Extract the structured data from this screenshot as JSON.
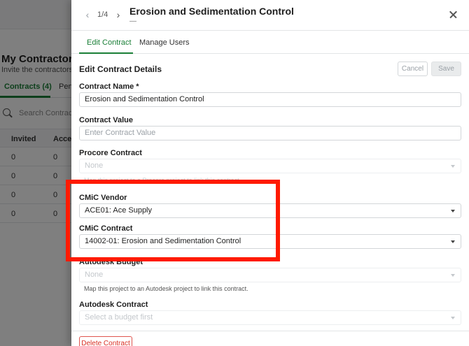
{
  "background": {
    "title": "My Contractor Us",
    "subtitle": "Invite the contractors or",
    "tabs": [
      {
        "label": "Contracts (4)",
        "active": true
      },
      {
        "label": "Penc",
        "active": false
      }
    ],
    "search_placeholder": "Search Contracts",
    "columns": [
      "Invited",
      "Accep"
    ],
    "rows": [
      [
        "0",
        "0"
      ],
      [
        "0",
        "0"
      ],
      [
        "0",
        "0"
      ],
      [
        "0",
        "0"
      ]
    ]
  },
  "drawer": {
    "pager": {
      "count": "1/4",
      "prev": "‹",
      "next": "›"
    },
    "title": "Erosion and Sedimentation Control",
    "subtitle": "—",
    "tabs": [
      {
        "label": "Edit Contract",
        "active": true
      },
      {
        "label": "Manage Users",
        "active": false
      }
    ],
    "section_title": "Edit Contract Details",
    "cancel_label": "Cancel",
    "save_label": "Save",
    "fields": {
      "contract_name": {
        "label": "Contract Name *",
        "value": "Erosion and Sedimentation Control"
      },
      "contract_value": {
        "label": "Contract Value",
        "placeholder": "Enter Contract Value"
      },
      "procore_contract": {
        "label": "Procore Contract",
        "value": "None",
        "helper": "Map this project to a Procore project to link this contract."
      },
      "cmic_vendor": {
        "label": "CMiC Vendor",
        "value": "ACE01: Ace Supply"
      },
      "cmic_contract": {
        "label": "CMiC Contract",
        "value": "14002-01: Erosion and Sedimentation Control"
      },
      "autodesk_budget": {
        "label": "Autodesk Budget",
        "value": "None",
        "helper": "Map this project to an Autodesk project to link this contract."
      },
      "autodesk_contract": {
        "label": "Autodesk Contract",
        "value": "Select a budget first"
      }
    },
    "delete_label": "Delete Contract"
  },
  "colors": {
    "accent": "#1a7f37",
    "highlight": "#ff1a00",
    "danger": "#d93025"
  }
}
